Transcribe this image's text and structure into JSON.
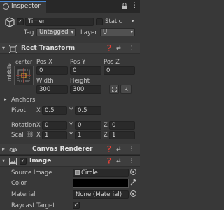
{
  "tab": {
    "label": "Inspector"
  },
  "object": {
    "name": "Timer",
    "active_checked": true,
    "static_label": "Static",
    "tag_label": "Tag",
    "tag_value": "Untagged",
    "layer_label": "Layer",
    "layer_value": "UI"
  },
  "rect_transform": {
    "title": "Rect Transform",
    "anchor_preset_top": "center",
    "anchor_preset_side": "middle",
    "pos_x_label": "Pos X",
    "pos_y_label": "Pos Y",
    "pos_z_label": "Pos Z",
    "pos_x": "0",
    "pos_y": "0",
    "pos_z": "0",
    "width_label": "Width",
    "height_label": "Height",
    "width": "300",
    "height": "300",
    "r_label": "R",
    "anchors_label": "Anchors",
    "pivot_label": "Pivot",
    "pivot_x_label": "X",
    "pivot_x": "0.5",
    "pivot_y_label": "Y",
    "pivot_y": "0.5",
    "rotation_label": "Rotation",
    "rot_x_label": "X",
    "rot_x": "0",
    "rot_y_label": "Y",
    "rot_y": "0",
    "rot_z_label": "Z",
    "rot_z": "0",
    "scale_label": "Scal",
    "scale_x_label": "X",
    "scale_x": "1",
    "scale_y_label": "Y",
    "scale_y": "1",
    "scale_z_label": "Z",
    "scale_z": "1"
  },
  "canvas_renderer": {
    "title": "Canvas Renderer"
  },
  "image": {
    "title": "Image",
    "enabled": true,
    "source_image_label": "Source Image",
    "source_image_value": "Circle",
    "color_label": "Color",
    "color_value": "#000000",
    "material_label": "Material",
    "material_value": "None (Material)",
    "raycast_label": "Raycast Target",
    "raycast_checked": true
  },
  "icons": [
    "info-icon",
    "lock-icon",
    "kebab-icon",
    "gameobject-cube-icon",
    "rect-transform-icon",
    "eye-icon",
    "image-icon",
    "help-icon",
    "presets-icon",
    "more-icon",
    "object-picker-icon",
    "eyedropper-icon",
    "blueprint-icon"
  ]
}
